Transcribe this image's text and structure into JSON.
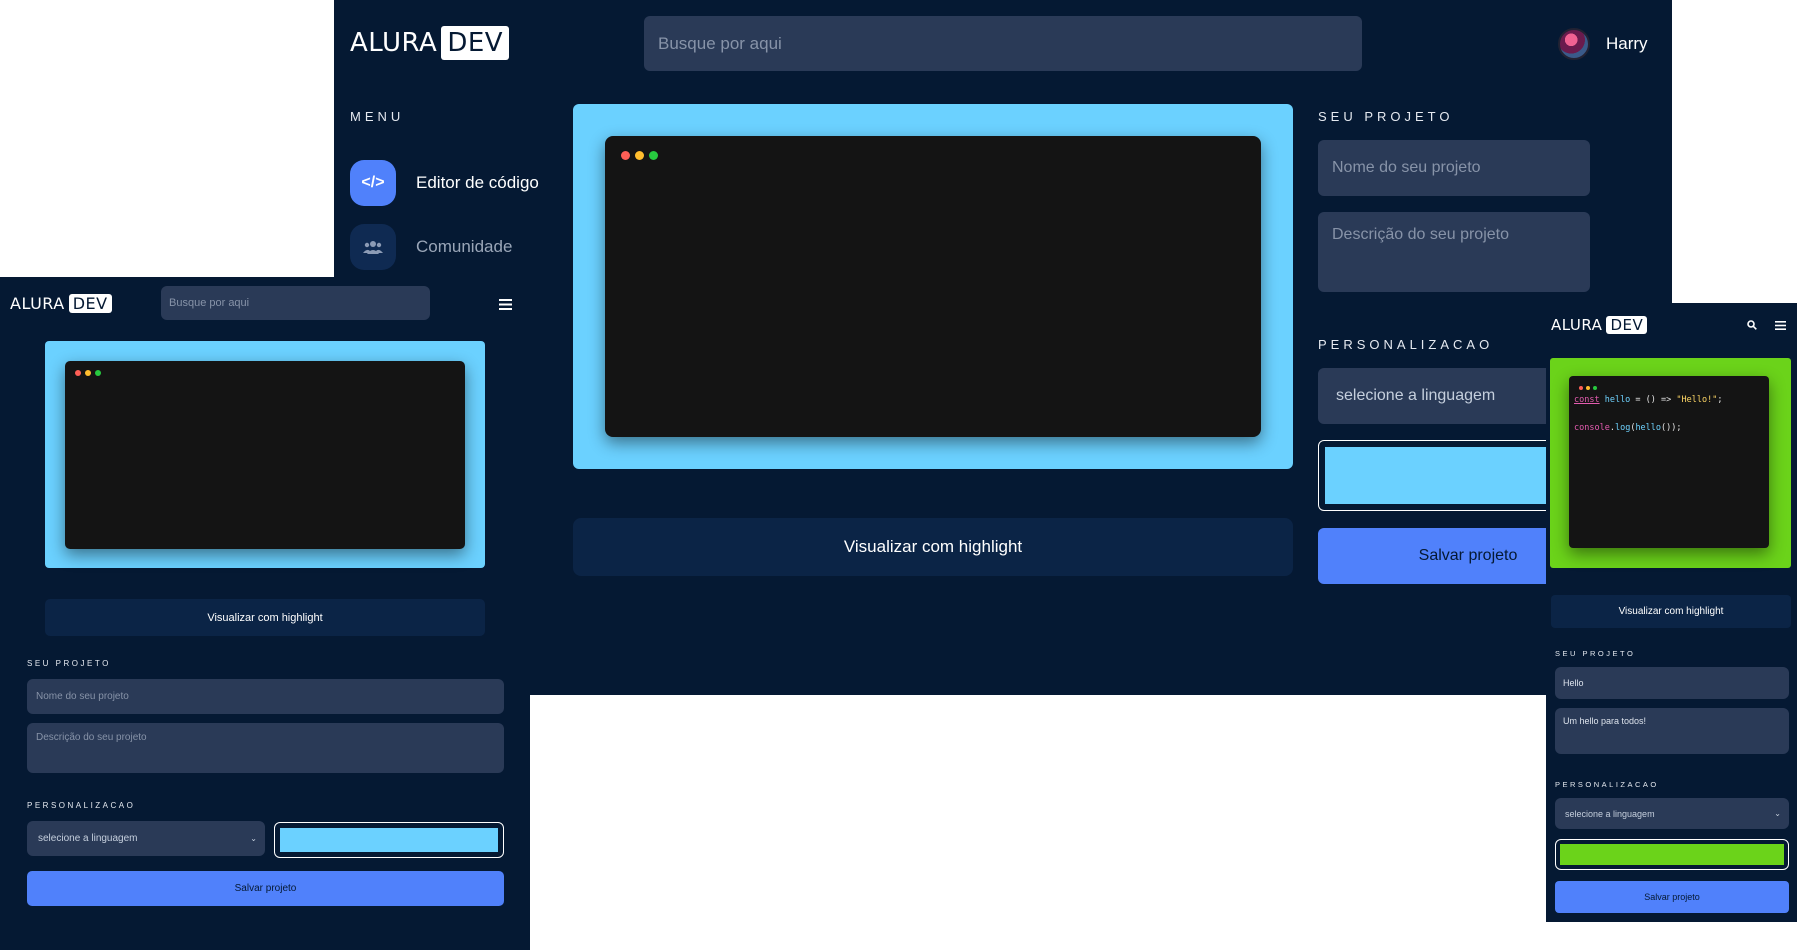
{
  "brand": {
    "name": "ALURA",
    "tag": "DEV"
  },
  "search": {
    "placeholder": "Busque por aqui"
  },
  "user": {
    "name": "Harry"
  },
  "menu": {
    "title": "MENU",
    "items": [
      {
        "label": "Editor de código",
        "icon": "code-icon",
        "active": true
      },
      {
        "label": "Comunidade",
        "icon": "users-icon",
        "active": false
      }
    ]
  },
  "editor": {
    "desktop_color": "#6bd1ff",
    "tablet_color": "#6bd1ff",
    "mobile_color": "#6bd31a",
    "code_lines": [
      [
        "const",
        " hello",
        " = () => ",
        "\"Hello!\"",
        ";"
      ],
      [
        "console",
        ".",
        "log",
        "(",
        "hello",
        "());"
      ]
    ]
  },
  "highlight_button": "Visualizar com highlight",
  "project": {
    "title": "SEU PROJETO",
    "name_placeholder": "Nome do seu projeto",
    "description_placeholder": "Descrição do seu projeto",
    "mobile_name_value": "Hello",
    "mobile_description_value": "Um hello para todos!"
  },
  "customize": {
    "title": "PERSONALIZACAO",
    "language_placeholder": "selecione a linguagem"
  },
  "save_button": "Salvar projeto",
  "icons": {
    "search": "search-icon",
    "menu": "hamburger-icon",
    "chevron": "chevron-down-icon"
  },
  "colors": {
    "background": "#051933",
    "accent": "#5081fb",
    "field": "#2a3a57"
  }
}
